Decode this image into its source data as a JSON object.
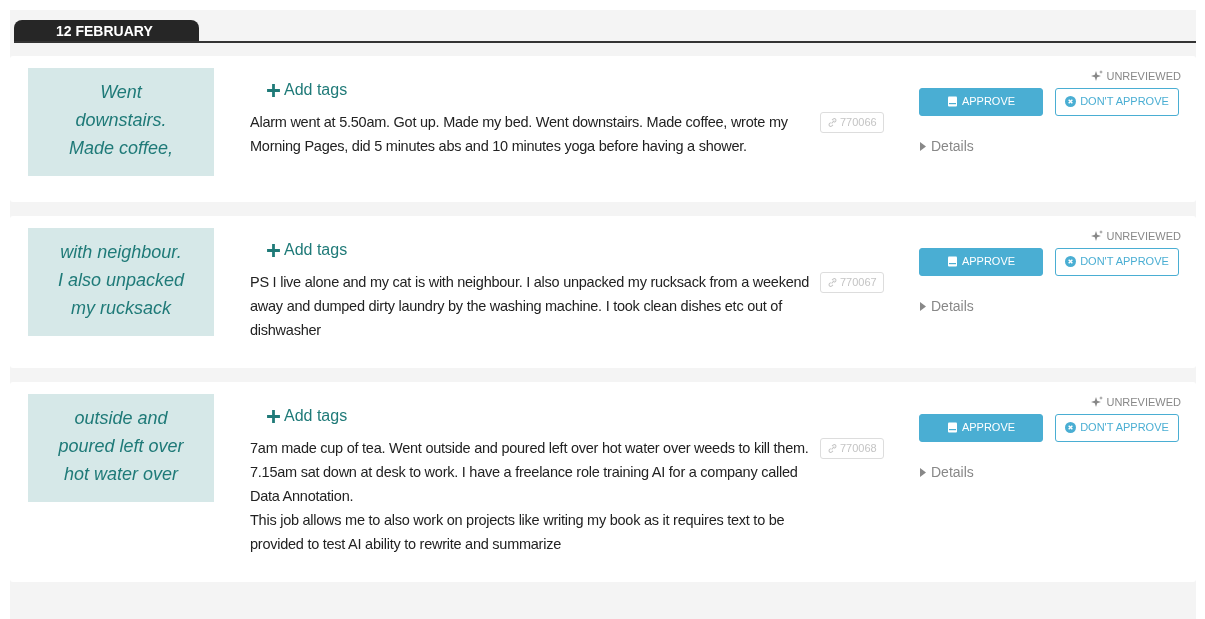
{
  "date_tab": {
    "label": "12 FEBRUARY"
  },
  "entries": [
    {
      "preview_lines": [
        "Went",
        "downstairs.",
        "Made coffee,"
      ],
      "add_tags": "Add tags",
      "body": [
        "Alarm went at 5.50am. Got up. Made my bed. Went downstairs. Made coffee, wrote my Morning Pages, did 5 minutes abs and 10 minutes yoga before having a shower."
      ],
      "ref": "770066",
      "status": "UNREVIEWED",
      "approve": "APPROVE",
      "reject": "DON'T APPROVE",
      "details": "Details",
      "expanded": false
    },
    {
      "preview_lines": [
        "with neighbour.",
        "I also unpacked",
        "my rucksack"
      ],
      "add_tags": "Add tags",
      "body": [
        "PS I live alone and my cat is with neighbour. I also unpacked my rucksack from a weekend away and dumped dirty laundry by the washing machine. I took clean dishes etc out of dishwasher"
      ],
      "ref": "770067",
      "status": "UNREVIEWED",
      "approve": "APPROVE",
      "reject": "DON'T APPROVE",
      "details": "Details",
      "expanded": false
    },
    {
      "preview_lines": [
        "outside and",
        "poured left over",
        "hot water over"
      ],
      "add_tags": "Add tags",
      "body": [
        "7am made cup of tea. Went outside and poured left over hot water over weeds to kill them.",
        "7.15am sat down at desk to work. I have a freelance role training AI for a company called Data Annotation.",
        "This job allows me to also work on projects like writing my book as it requires text to be provided to test AI ability to rewrite and summarize"
      ],
      "ref": "770068",
      "status": "UNREVIEWED",
      "approve": "APPROVE",
      "reject": "DON'T APPROVE",
      "details": "Details",
      "expanded": false
    }
  ]
}
